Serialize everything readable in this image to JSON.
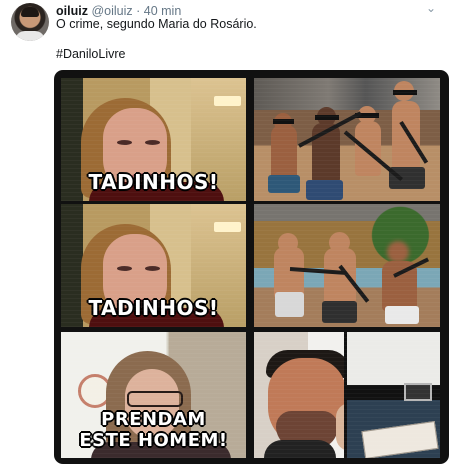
{
  "tweet": {
    "display_name": "oiluiz",
    "handle": "@oiluiz",
    "separator": "·",
    "time": "40 min",
    "text": "O crime, segundo Maria do Rosário.",
    "hashtag": "#DaniloLivre"
  },
  "icons": {
    "avatar": "profile-avatar",
    "menu": "chevron-down-icon"
  },
  "captions": {
    "panel1": "TADINHOS!",
    "panel2": "TADINHOS!",
    "panel3_line1": "PRENDAM",
    "panel3_line2": "ESTE HOMEM!"
  },
  "colors": {
    "background": "#ffffff",
    "text": "#14171a",
    "muted": "#657786",
    "media_frame": "#111111"
  }
}
